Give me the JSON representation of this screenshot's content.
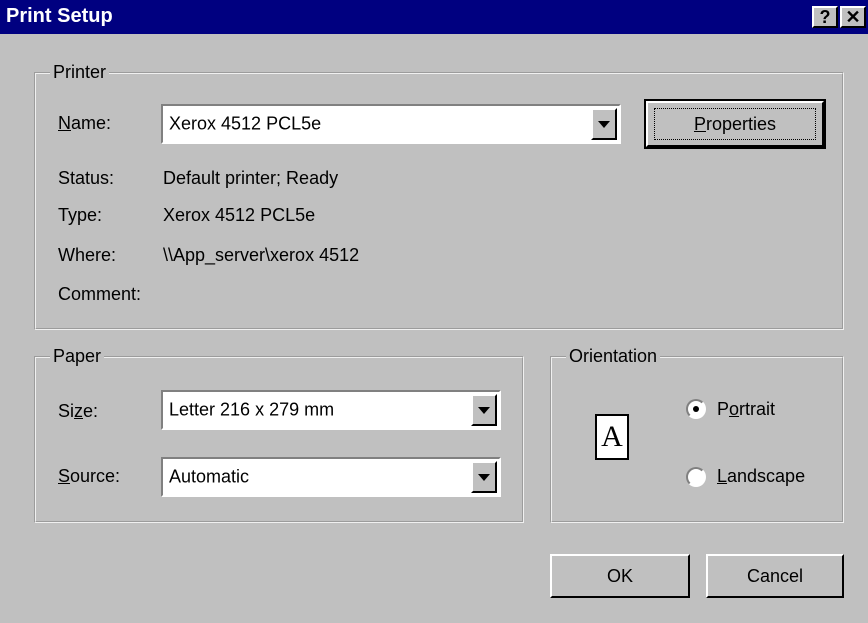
{
  "window": {
    "title": "Print Setup",
    "help_glyph": "?",
    "close_glyph": "✕"
  },
  "printer": {
    "legend": "Printer",
    "name_label_u": "N",
    "name_label_rest": "ame:",
    "name_value": "Xerox 4512 PCL5e",
    "properties_u": "P",
    "properties_rest": "roperties",
    "status_label": "Status:",
    "status_value": "Default printer; Ready",
    "type_label": "Type:",
    "type_value": "Xerox 4512 PCL5e",
    "where_label": "Where:",
    "where_value": "\\\\App_server\\xerox 4512",
    "comment_label": "Comment:"
  },
  "paper": {
    "legend": "Paper",
    "size_label_pre": "Si",
    "size_label_u": "z",
    "size_label_post": "e:",
    "size_value": "Letter 216 x 279 mm",
    "source_label_u": "S",
    "source_label_rest": "ource:",
    "source_value": "Automatic"
  },
  "orientation": {
    "legend": "Orientation",
    "icon_letter": "A",
    "portrait_pre": "P",
    "portrait_u": "o",
    "portrait_post": "rtrait",
    "landscape_u": "L",
    "landscape_rest": "andscape",
    "selected": "Portrait"
  },
  "buttons": {
    "ok": "OK",
    "cancel": "Cancel"
  }
}
